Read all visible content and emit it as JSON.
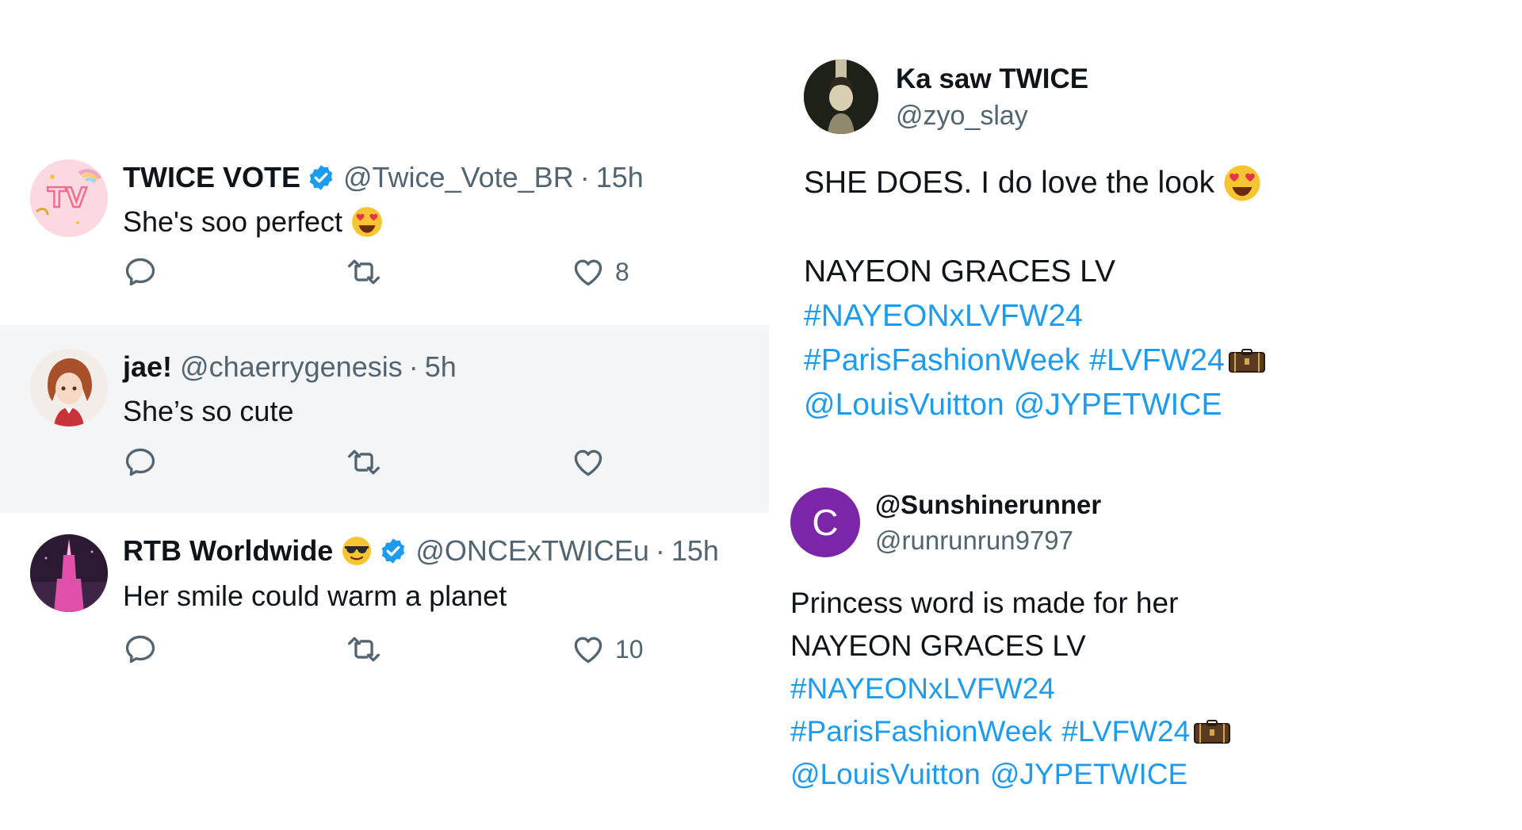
{
  "replies": [
    {
      "name": "TWICE VOTE",
      "verified": true,
      "handle": "@Twice_Vote_BR",
      "separator": "·",
      "time": "15h",
      "text": "She's soo perfect",
      "emoji": "heart-eyes-emoji",
      "like_count": "8",
      "avatar_text": "TV"
    },
    {
      "name": "jae!",
      "verified": false,
      "handle": "@chaerrygenesis",
      "separator": "·",
      "time": "5h",
      "text": "She’s so cute",
      "like_count": ""
    },
    {
      "name": "RTB Worldwide",
      "name_emoji": "sunglasses-emoji",
      "verified": true,
      "handle": "@ONCExTWICEu",
      "separator": "·",
      "time": "15h",
      "text": "Her smile could warm a planet",
      "like_count": "10"
    }
  ],
  "tweet1": {
    "name": "Ka saw TWICE",
    "handle": "@zyo_slay",
    "line1": "SHE DOES. I do love the look",
    "line1_emoji": "heart-eyes-emoji",
    "line2": "NAYEON GRACES LV",
    "hashtag1": "#NAYEONxLVFW24",
    "hashtag2": "#ParisFashionWeek",
    "hashtag3": "#LVFW24",
    "hashtag3_emoji": "trunk-emoji",
    "mention1": "@LouisVuitton",
    "mention2": "@JYPETWICE"
  },
  "tweet2": {
    "name": "@Sunshinerunner",
    "handle": "@runrunrun9797",
    "avatar_letter": "C",
    "avatar_color": "#7b25a8",
    "line1": "Princess word is made for her",
    "line2": "NAYEON GRACES LV",
    "hashtag1": "#NAYEONxLVFW24",
    "hashtag2": "#ParisFashionWeek",
    "hashtag3": "#LVFW24",
    "hashtag3_emoji": "trunk-emoji",
    "mention1": "@LouisVuitton",
    "mention2": "@JYPETWICE"
  },
  "colors": {
    "link": "#1d9bf0",
    "secondary_text": "#536471",
    "verified": "#1d9bf0",
    "highlight_row": "#f4f5f7"
  }
}
